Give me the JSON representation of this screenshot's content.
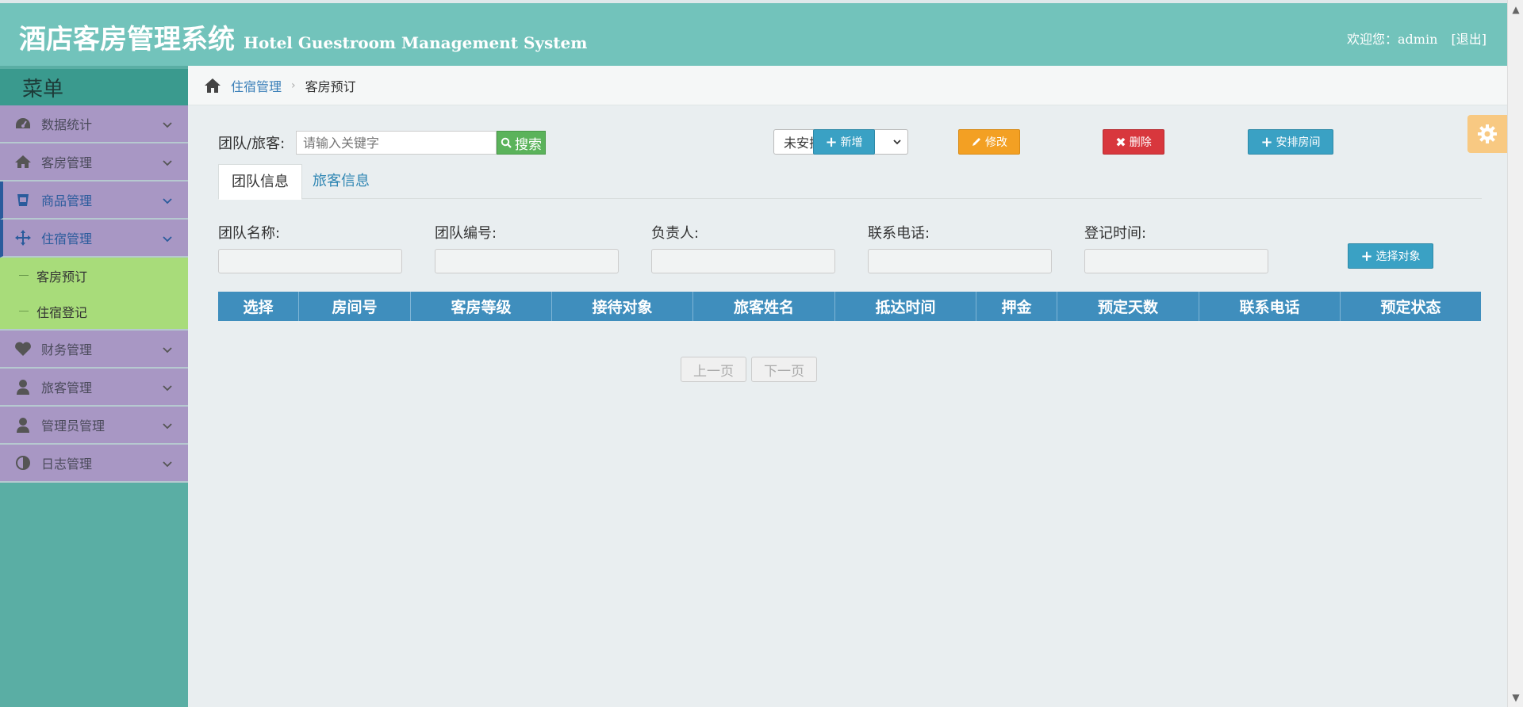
{
  "header": {
    "title_cn": "酒店客房管理系统",
    "title_en": "Hotel Guestroom Management System",
    "welcome": "欢迎您：admin",
    "logout": "[退出]"
  },
  "sidebar": {
    "menu_title": "菜单",
    "items": [
      {
        "label": "数据统计",
        "icon": "dashboard-icon"
      },
      {
        "label": "客房管理",
        "icon": "home-icon"
      },
      {
        "label": "商品管理",
        "icon": "cup-icon"
      },
      {
        "label": "住宿管理",
        "icon": "move-icon"
      },
      {
        "label": "财务管理",
        "icon": "heart-icon"
      },
      {
        "label": "旅客管理",
        "icon": "user-icon"
      },
      {
        "label": "管理员管理",
        "icon": "user-icon"
      },
      {
        "label": "日志管理",
        "icon": "adjust-icon"
      }
    ],
    "sub_items": [
      "客房预订",
      "住宿登记"
    ]
  },
  "breadcrumb": {
    "parent": "住宿管理",
    "current": "客房预订"
  },
  "toolbar": {
    "search_label": "团队/旅客:",
    "search_placeholder": "请输入关键字",
    "search_button": "搜索",
    "status_select": "未安排",
    "add_button": "新增",
    "edit_button": "修改",
    "delete_button": "删除",
    "arrange_button": "安排房间"
  },
  "tabs": {
    "team": "团队信息",
    "guest": "旅客信息"
  },
  "form": {
    "team_name": "团队名称:",
    "team_no": "团队编号:",
    "leader": "负责人:",
    "phone": "联系电话:",
    "reg_time": "登记时间:",
    "select_button": "选择对象"
  },
  "table": {
    "headers": [
      "选择",
      "房间号",
      "客房等级",
      "接待对象",
      "旅客姓名",
      "抵达时间",
      "押金",
      "预定天数",
      "联系电话",
      "预定状态"
    ]
  },
  "pager": {
    "prev": "上一页",
    "next": "下一页"
  },
  "colors": {
    "header_bg": "#72c3bb",
    "sidebar_item_bg": "#a897c4",
    "submenu_bg": "#a8dc7a",
    "table_header_bg": "#3f8ebd"
  }
}
